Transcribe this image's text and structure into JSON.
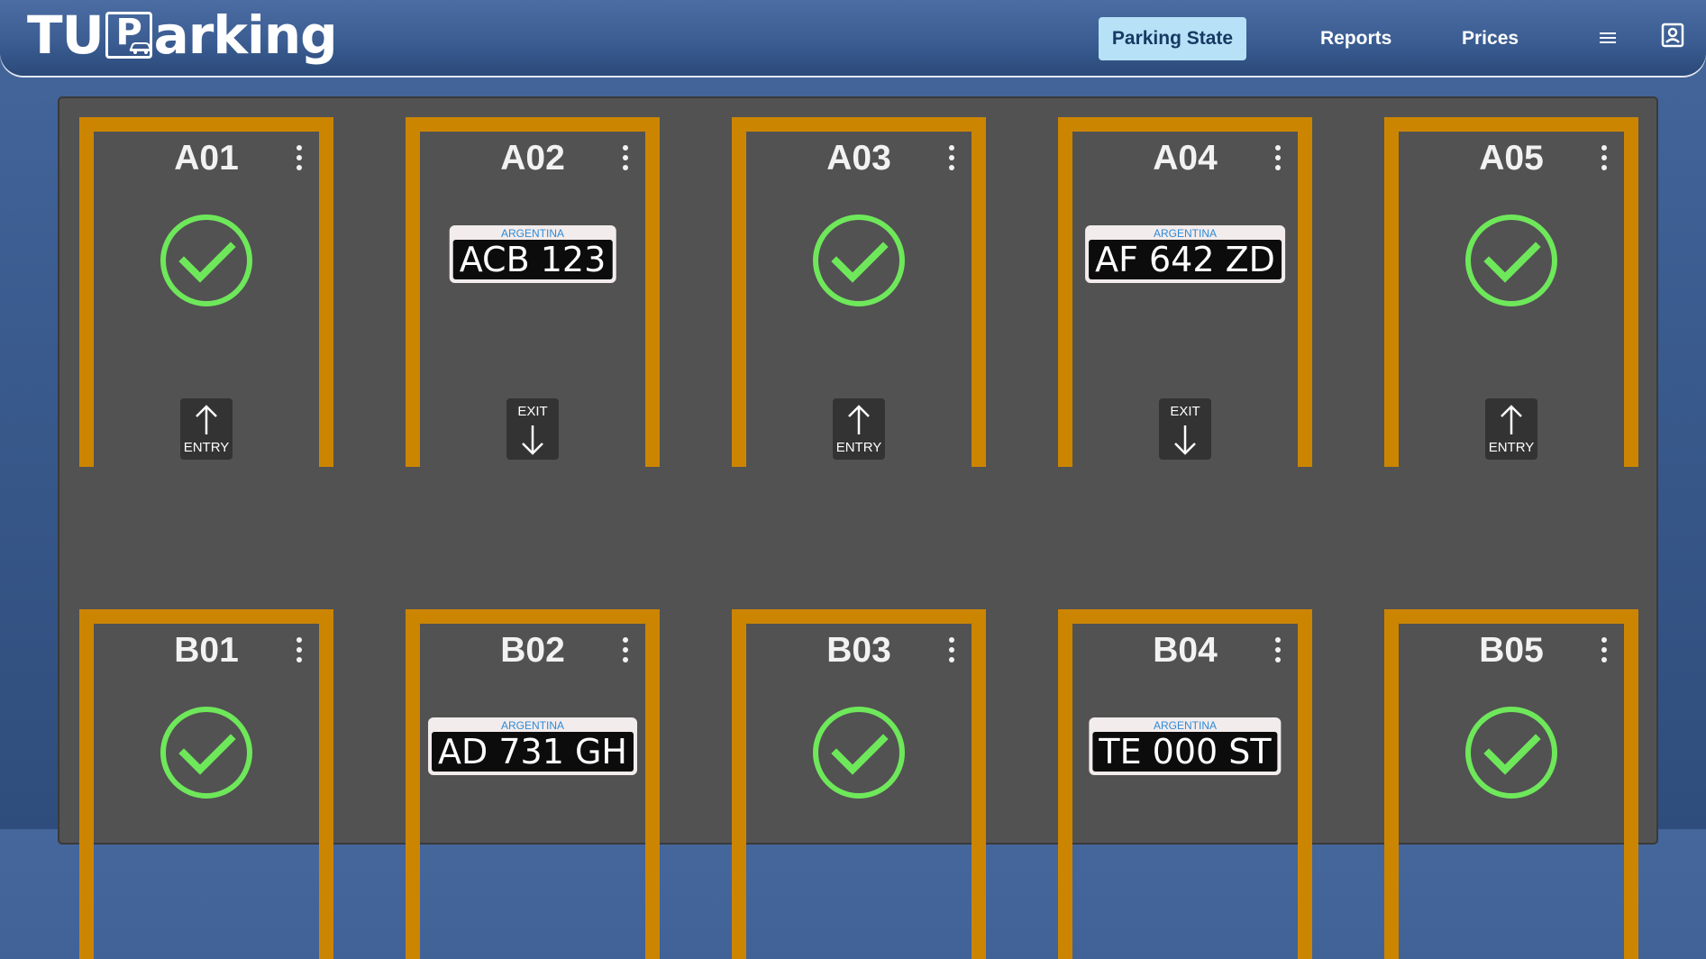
{
  "header": {
    "logo_prefix": "TU",
    "logo_p": "P",
    "logo_suffix": "arking",
    "nav": {
      "parking_state": "Parking State",
      "reports": "Reports",
      "prices": "Prices"
    },
    "icons": [
      "menu-icon",
      "account-icon"
    ],
    "colors": {
      "active_nav_bg": "#b7e1f7",
      "active_nav_text": "#163a63"
    }
  },
  "lot": {
    "colors": {
      "spot_border": "#cc8500",
      "free_check": "#6ee85a",
      "lot_bg": "#525252"
    },
    "spots": [
      {
        "id": "A01",
        "status": "free",
        "action": "ENTRY"
      },
      {
        "id": "A02",
        "status": "occupied",
        "plate_country": "ARGENTINA",
        "plate": "ACB 123",
        "action": "EXIT"
      },
      {
        "id": "A03",
        "status": "free",
        "action": "ENTRY"
      },
      {
        "id": "A04",
        "status": "occupied",
        "plate_country": "ARGENTINA",
        "plate": "AF 642 ZD",
        "action": "EXIT"
      },
      {
        "id": "A05",
        "status": "free",
        "action": "ENTRY"
      },
      {
        "id": "B01",
        "status": "free"
      },
      {
        "id": "B02",
        "status": "occupied",
        "plate_country": "ARGENTINA",
        "plate": "AD 731 GH"
      },
      {
        "id": "B03",
        "status": "free"
      },
      {
        "id": "B04",
        "status": "occupied",
        "plate_country": "ARGENTINA",
        "plate": "TE 000 ST"
      },
      {
        "id": "B05",
        "status": "free"
      }
    ]
  }
}
